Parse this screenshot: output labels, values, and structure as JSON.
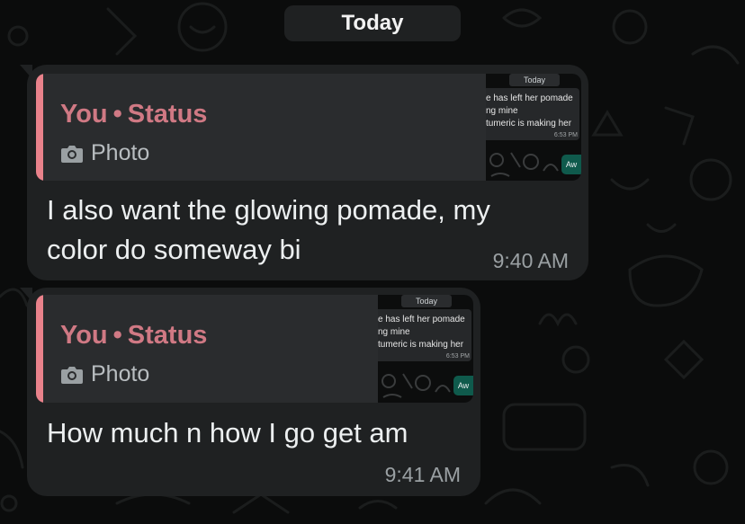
{
  "date_separator": "Today",
  "messages": [
    {
      "reply": {
        "sender": "You",
        "separator": "•",
        "source": "Status",
        "media_label": "Photo",
        "thumbnail": {
          "date_chip": "Today",
          "lines": [
            "e has left her pomade",
            "ng mine",
            "tumeric is making her"
          ],
          "time": "6:53 PM",
          "button": "Aw"
        }
      },
      "text": "I also want the glowing pomade, my color do someway bi",
      "time": "9:40 AM"
    },
    {
      "reply": {
        "sender": "You",
        "separator": "•",
        "source": "Status",
        "media_label": "Photo",
        "thumbnail": {
          "date_chip": "Today",
          "lines": [
            "e has left her pomade",
            "ng mine",
            "tumeric is making her"
          ],
          "time": "6:53 PM",
          "button": "Aw"
        }
      },
      "text": "How much n how I go get am",
      "time": "9:41 AM"
    }
  ],
  "colors": {
    "background": "#0b0c0c",
    "bubble": "#1f2122",
    "quote_bar": "#e9828b",
    "quote_title": "#d07984",
    "accent_green": "#0f5a4c"
  }
}
